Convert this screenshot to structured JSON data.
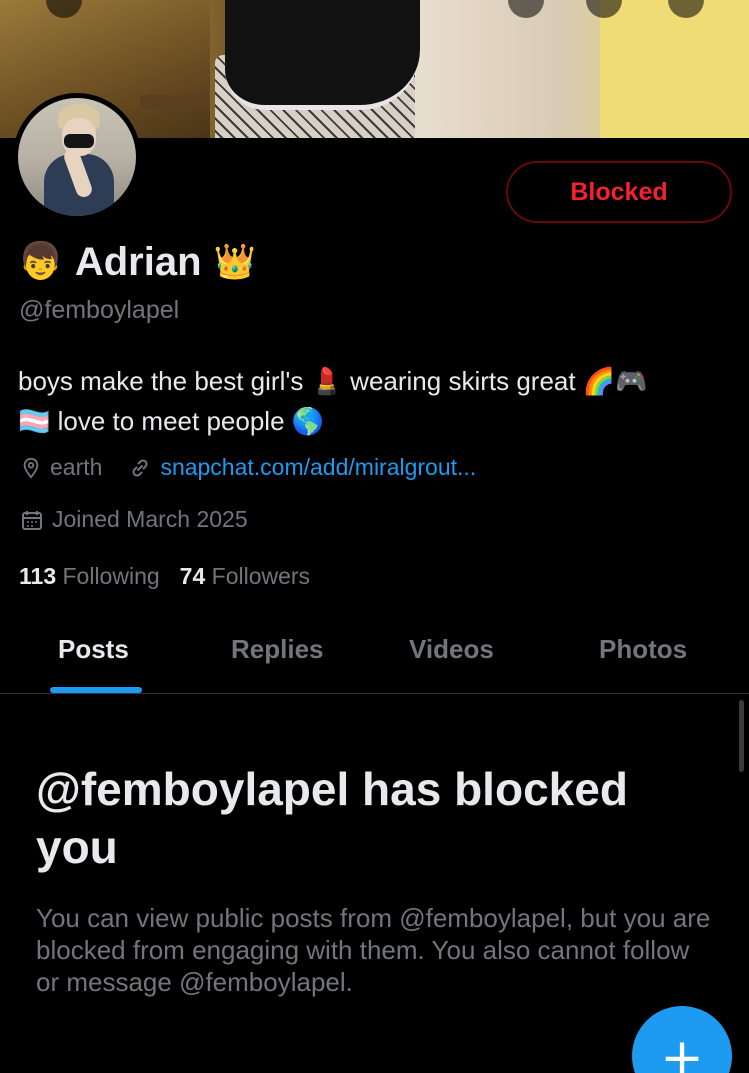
{
  "profile": {
    "name": "Adrian",
    "name_prefix_emoji": "👦",
    "name_suffix_emoji": "👑",
    "handle": "@femboylapel",
    "relationship_button": "Blocked",
    "bio": {
      "line1_a": "boys make the best girl's",
      "line1_emoji_a": "💄",
      "line1_b": "wearing skirts great",
      "line1_emoji_b": "🌈🎮",
      "line2_emoji_a": "🏳️‍⚧️",
      "line2_text": "love to meet people",
      "line2_emoji_b": "🌎"
    },
    "location": "earth",
    "website": "snapchat.com/add/miralgrout...",
    "joined": "Joined March 2025",
    "following_count": "113",
    "following_label": "Following",
    "followers_count": "74",
    "followers_label": "Followers"
  },
  "tabs": [
    {
      "label": "Posts",
      "active": true
    },
    {
      "label": "Replies",
      "active": false
    },
    {
      "label": "Videos",
      "active": false
    },
    {
      "label": "Photos",
      "active": false
    }
  ],
  "blocked_notice": {
    "title": "@femboylapel has blocked you",
    "description": "You can view public posts from @femboylapel, but you are blocked from engaging with them. You also cannot follow or message @femboylapel."
  },
  "fab": {
    "icon": "plus-icon",
    "glyph": "+"
  },
  "colors": {
    "background": "#000000",
    "text_primary": "#e7e9ea",
    "text_secondary": "#71767b",
    "accent": "#1d9bf0",
    "blocked_red": "#f4212e",
    "blocked_border": "#67070f"
  }
}
